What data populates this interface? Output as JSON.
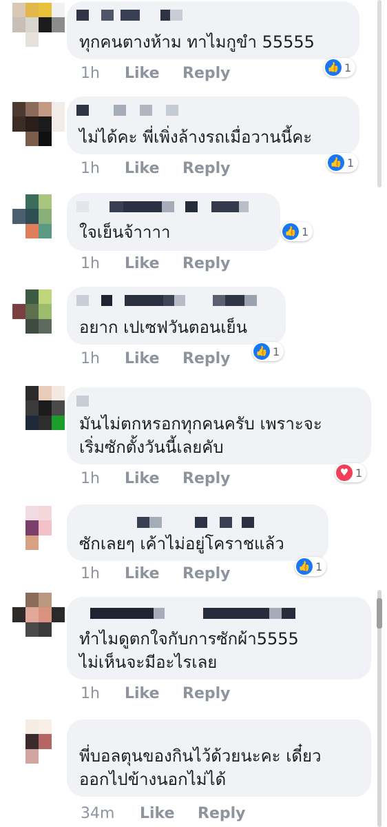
{
  "comments": [
    {
      "text_lines": [
        "ทุกคนตางห้าม ทาไมกูขำ 55555"
      ],
      "time": "1h",
      "like_label": "Like",
      "reply_label": "Reply",
      "reaction": {
        "icon": "thumbs-up-icon",
        "count": "1"
      }
    },
    {
      "text_lines": [
        "ไม่ได้คะ พี่เพิ่งล้างรถเมื่อวานนี้คะ"
      ],
      "time": "1h",
      "like_label": "Like",
      "reply_label": "Reply",
      "reaction": {
        "icon": "thumbs-up-icon",
        "count": "1"
      }
    },
    {
      "text_lines": [
        "ใจเย็นจ้าาาา"
      ],
      "time": "1h",
      "like_label": "Like",
      "reply_label": "Reply",
      "reaction": {
        "icon": "thumbs-up-icon",
        "count": "1"
      }
    },
    {
      "text_lines": [
        "อยาก เปเซฟวันตอนเย็น"
      ],
      "time": "1h",
      "like_label": "Like",
      "reply_label": "Reply",
      "reaction": {
        "icon": "thumbs-up-icon",
        "count": "1"
      }
    },
    {
      "text_lines": [
        "มันไม่ตกหรอกทุกคนครับ เพราะจะ",
        "เริ่มซักตั้งวันนี้เลยคับ"
      ],
      "time": "1h",
      "like_label": "Like",
      "reply_label": "Reply",
      "reaction": {
        "icon": "heart-icon",
        "count": "1"
      }
    },
    {
      "text_lines": [
        "ซักเลยๆ เค้าไม่อยู่โคราชแล้ว"
      ],
      "time": "1h",
      "like_label": "Like",
      "reply_label": "Reply",
      "reaction": {
        "icon": "thumbs-up-icon",
        "count": "1"
      }
    },
    {
      "text_lines": [
        "ทำไมดูตกใจกับการซักผ้า5555",
        "ไม่เห็นจะมีอะไรเลย"
      ],
      "time": "1h",
      "like_label": "Like",
      "reply_label": "Reply",
      "reaction": null
    },
    {
      "text_lines": [
        "พี่บอลตุนของกินไว้ด้วยนะคะ เดี๋ยว",
        "ออกไปข้างนอกไม่ได้"
      ],
      "time": "34m",
      "like_label": "Like",
      "reply_label": "Reply",
      "reaction": null
    }
  ],
  "colors": {
    "bubble": "#f0f2f5",
    "text": "#1c1e21",
    "meta": "#8d949e",
    "like_blue": "#1877f2",
    "love_red": "#f33e58"
  }
}
